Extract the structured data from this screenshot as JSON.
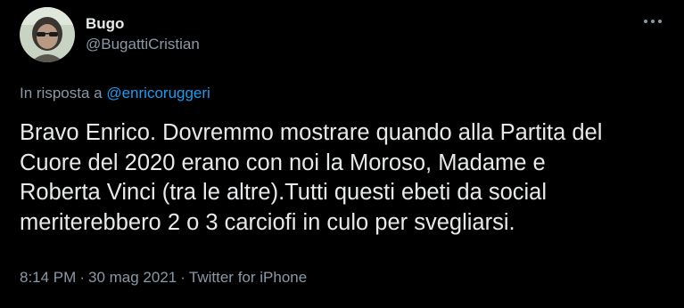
{
  "user": {
    "display_name": "Bugo",
    "handle": "@BugattiCristian"
  },
  "more_icon": "more-horizontal-icon",
  "reply": {
    "prefix": "In risposta a",
    "mention": "@enricoruggeri"
  },
  "tweet": {
    "lines": [
      "Bravo Enrico. Dovremmo mostrare quando alla Partita del",
      "Cuore del 2020 erano con noi la Moroso, Madame e",
      "Roberta Vinci (tra le altre).Tutti questi ebeti da social",
      "meriterebbero 2 o 3 carciofi in culo per svegliarsi."
    ]
  },
  "meta": {
    "time": "8:14 PM",
    "date": "30 mag 2021",
    "source": "Twitter for iPhone",
    "separator": "·"
  },
  "colors": {
    "background": "#000000",
    "text": "#e7e9ea",
    "secondary": "#8b98a5",
    "link": "#1d9bf0"
  }
}
